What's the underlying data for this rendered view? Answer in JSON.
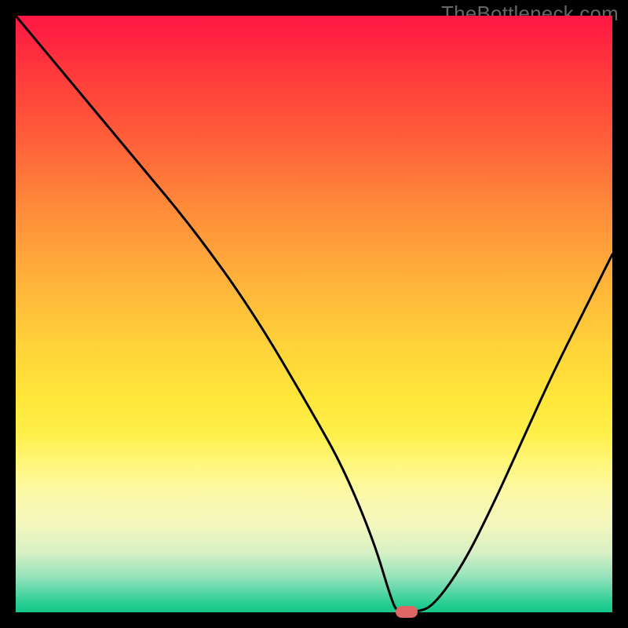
{
  "watermark": "TheBottleneck.com",
  "chart_data": {
    "type": "line",
    "title": "",
    "xlabel": "",
    "ylabel": "",
    "xlim": [
      0,
      100
    ],
    "ylim": [
      0,
      100
    ],
    "x": [
      0,
      10,
      20,
      30,
      40,
      50,
      55,
      60,
      63,
      64,
      67,
      70,
      75,
      80,
      85,
      90,
      95,
      100
    ],
    "values": [
      100,
      88,
      76,
      64,
      50,
      33,
      24,
      12,
      2,
      0,
      0,
      1,
      8,
      18,
      29,
      40,
      50,
      60
    ],
    "marker": {
      "x": 65.5,
      "y": 0
    },
    "gradient_colors": {
      "top": "#ff1744",
      "mid": "#ffd43a",
      "bottom": "#17c687"
    }
  }
}
